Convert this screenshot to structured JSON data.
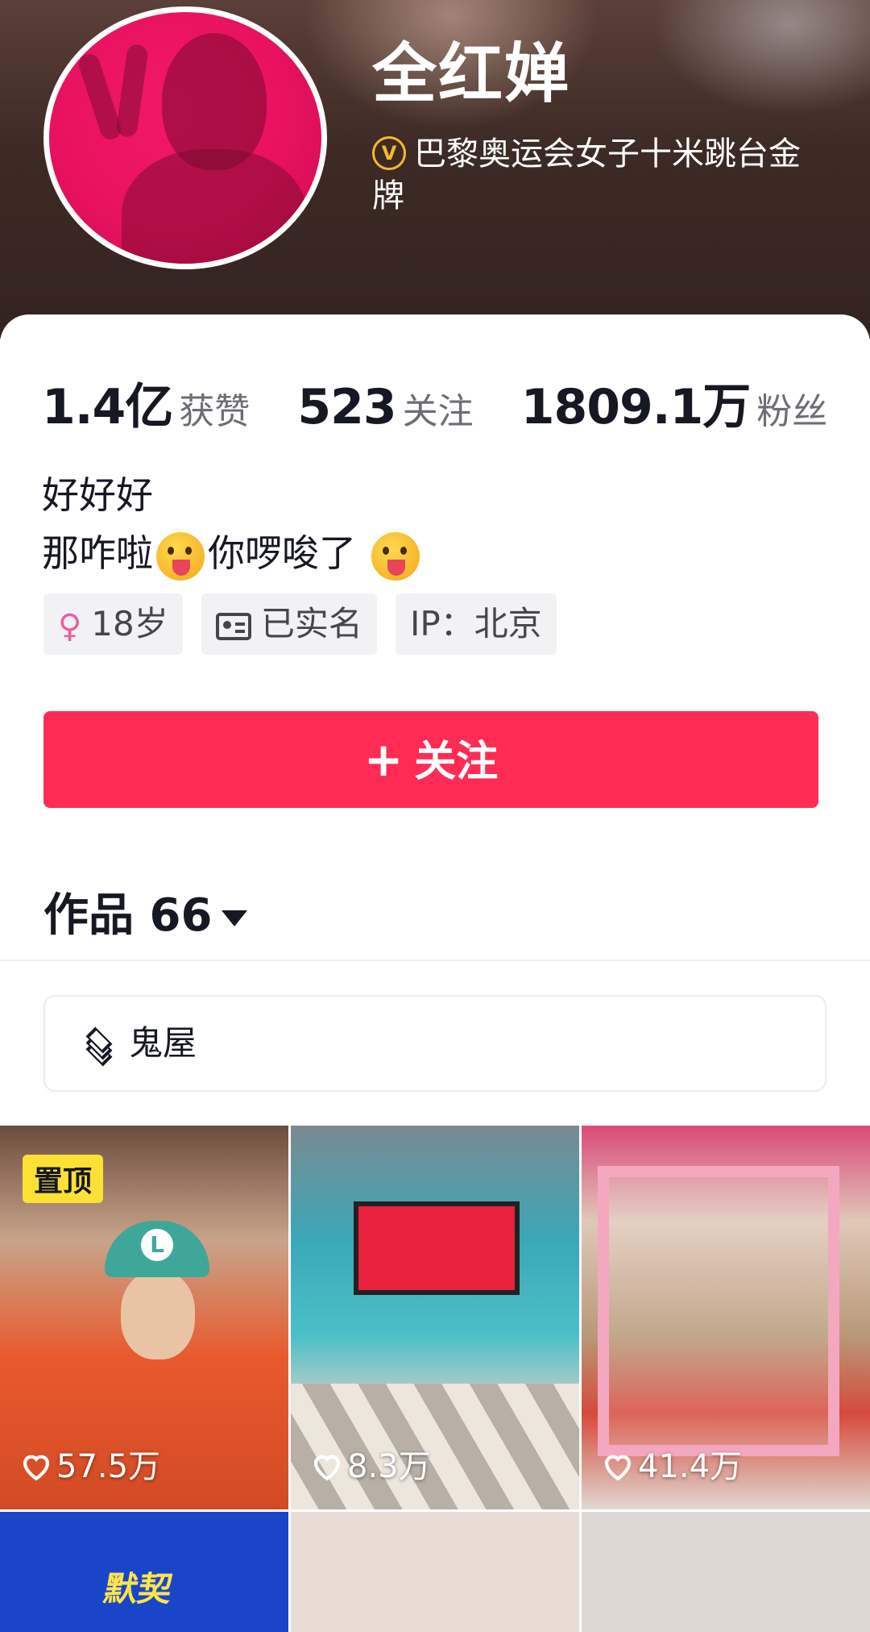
{
  "profile": {
    "name": "全红婵",
    "verification": "巴黎奥运会女子十米跳台金牌",
    "verified_badge": "V"
  },
  "stats": [
    {
      "value": "1.4亿",
      "label": "获赞"
    },
    {
      "value": "523",
      "label": "关注"
    },
    {
      "value": "1809.1万",
      "label": "粉丝"
    }
  ],
  "bio": {
    "line1": "好好好",
    "line2_a": "那咋啦",
    "line2_b": "你啰唆了"
  },
  "tags": {
    "age": "18岁",
    "real_name": "已实名",
    "ip": "IP：北京"
  },
  "follow_button": {
    "plus": "+",
    "label": "关注"
  },
  "works": {
    "label": "作品 66"
  },
  "collection": {
    "label": "鬼屋"
  },
  "videos": [
    {
      "likes": "57.5万",
      "pinned": "置顶"
    },
    {
      "likes": "8.3万"
    },
    {
      "likes": "41.4万"
    },
    {
      "overlay": "默契"
    },
    {},
    {}
  ],
  "colors": {
    "accent": "#fe2c55",
    "pin": "#fde034",
    "verified": "#f5b82e"
  }
}
